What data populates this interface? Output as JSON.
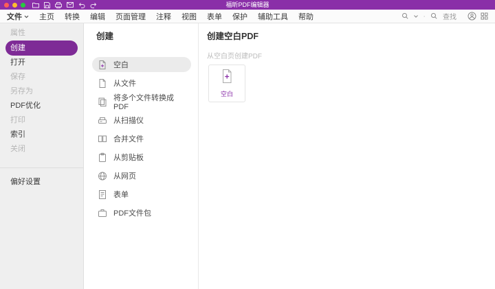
{
  "colors": {
    "titlebar_bg": "#8A2FA8",
    "accent_purple": "#8A2FA8",
    "selected_pill": "#7E2B96",
    "sidebar_bg": "#EFEFEF",
    "list_selected_bg": "#EBEBEB",
    "traffic_red": "#FF5F57",
    "traffic_yellow": "#FEBC2E",
    "traffic_green": "#28C840"
  },
  "titlebar": {
    "title": "福昕PDF编辑器",
    "window_controls": [
      "close",
      "minimize",
      "zoom"
    ],
    "icon_names": [
      "open-icon",
      "save-icon",
      "print-icon",
      "mail-icon",
      "undo-icon",
      "redo-icon"
    ]
  },
  "menubar": {
    "items": [
      {
        "label": "文件",
        "has_chevron": true
      },
      {
        "label": "主页"
      },
      {
        "label": "转换"
      },
      {
        "label": "编辑"
      },
      {
        "label": "页面管理"
      },
      {
        "label": "注释"
      },
      {
        "label": "视图"
      },
      {
        "label": "表单"
      },
      {
        "label": "保护"
      },
      {
        "label": "辅助工具"
      },
      {
        "label": "帮助"
      }
    ],
    "right": {
      "find_label": "查找",
      "icon_names": [
        "zoom-select-icon",
        "search-icon",
        "account-icon",
        "apps-icon"
      ]
    }
  },
  "sidebar": {
    "items": [
      {
        "label": "属性",
        "state": "disabled"
      },
      {
        "label": "创建",
        "state": "selected"
      },
      {
        "label": "打开",
        "state": "normal"
      },
      {
        "label": "保存",
        "state": "disabled"
      },
      {
        "label": "另存为",
        "state": "disabled"
      },
      {
        "label": "PDF优化",
        "state": "normal"
      },
      {
        "label": "打印",
        "state": "disabled"
      },
      {
        "label": "索引",
        "state": "normal"
      },
      {
        "label": "关闭",
        "state": "disabled"
      }
    ],
    "footer_item": {
      "label": "偏好设置"
    }
  },
  "create_panel": {
    "title": "创建",
    "items": [
      {
        "label": "空白",
        "selected": true
      },
      {
        "label": "从文件"
      },
      {
        "label": "将多个文件转换成PDF"
      },
      {
        "label": "从扫描仪"
      },
      {
        "label": "合并文件"
      },
      {
        "label": "从剪贴板"
      },
      {
        "label": "从网页"
      },
      {
        "label": "表单"
      },
      {
        "label": "PDF文件包"
      }
    ]
  },
  "detail_panel": {
    "title": "创建空白PDF",
    "subtitle": "从空白页创建PDF",
    "card": {
      "label": "空白"
    }
  }
}
